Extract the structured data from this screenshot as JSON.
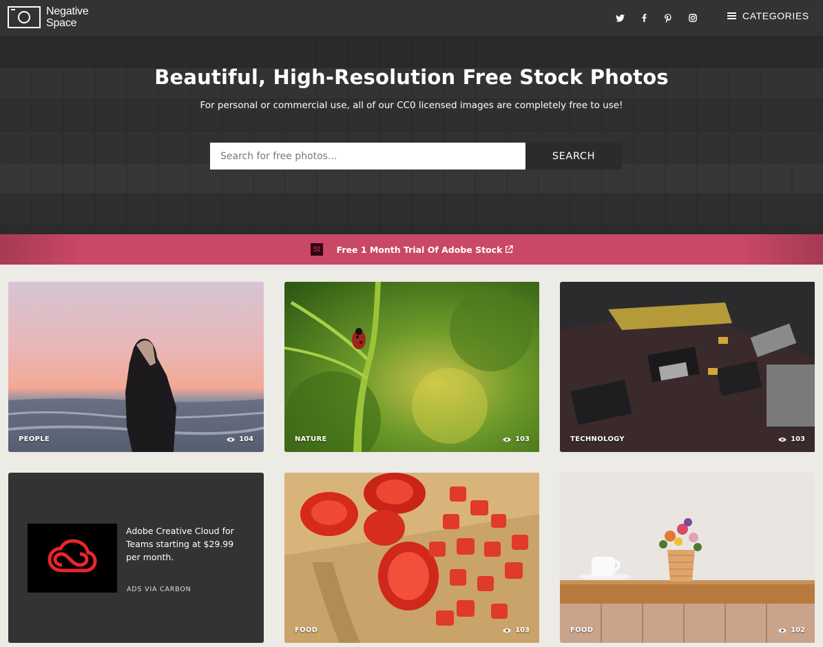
{
  "brand": {
    "name_line1": "Negative",
    "name_line2": "Space"
  },
  "nav": {
    "social": [
      {
        "icon": "twitter-icon"
      },
      {
        "icon": "facebook-icon"
      },
      {
        "icon": "pinterest-icon"
      },
      {
        "icon": "instagram-icon"
      }
    ],
    "categories_label": "CATEGORIES"
  },
  "hero": {
    "title": "Beautiful, High-Resolution Free Stock Photos",
    "subtitle": "For personal or commercial use, all of our CC0 licensed images are completely free to use!",
    "search_placeholder": "Search for free photos...",
    "search_button": "SEARCH"
  },
  "promo": {
    "badge": "St",
    "text": "Free 1 Month Trial Of Adobe Stock"
  },
  "cards": [
    {
      "category": "PEOPLE",
      "views": "104"
    },
    {
      "category": "NATURE",
      "views": "103"
    },
    {
      "category": "TECHNOLOGY",
      "views": "103"
    },
    {
      "category": "FOOD",
      "views": "103"
    },
    {
      "category": "FOOD",
      "views": "102"
    }
  ],
  "ad": {
    "text": "Adobe Creative Cloud for Teams starting at $29.99 per month.",
    "via": "ADS VIA CARBON"
  },
  "colors": {
    "nav_bg": "#333333",
    "promo_bg": "#c94866",
    "page_bg": "#ecebe6"
  }
}
